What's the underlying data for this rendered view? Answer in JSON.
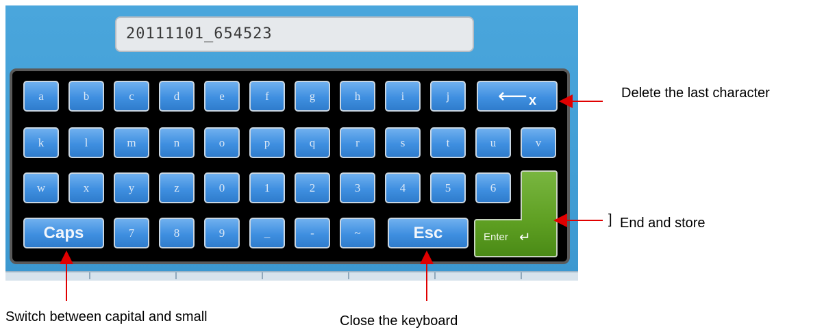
{
  "filename": {
    "value": "20111101_654523"
  },
  "keyboard": {
    "rows": [
      [
        "a",
        "b",
        "c",
        "d",
        "e",
        "f",
        "g",
        "h",
        "i",
        "j"
      ],
      [
        "k",
        "l",
        "m",
        "n",
        "o",
        "p",
        "q",
        "r",
        "s",
        "t",
        "u",
        "v"
      ],
      [
        "w",
        "x",
        "y",
        "z",
        "0",
        "1",
        "2",
        "3",
        "4",
        "5",
        "6"
      ],
      [
        "7",
        "8",
        "9",
        "_",
        "-",
        "~"
      ]
    ],
    "caps_label": "Caps",
    "esc_label": "Esc",
    "enter_label": "Enter",
    "enter_glyph": "↵",
    "backspace_arrow": "⟵",
    "backspace_x": "x",
    "enter_color": "#5e9f22",
    "key_color": "#3f8fe0"
  },
  "annotations": {
    "delete": "Delete the last character",
    "enter_mark": "]",
    "enter": "End and store",
    "caps": "Switch between capital and small",
    "esc": "Close the keyboard"
  },
  "arrow_color": "#e00000"
}
